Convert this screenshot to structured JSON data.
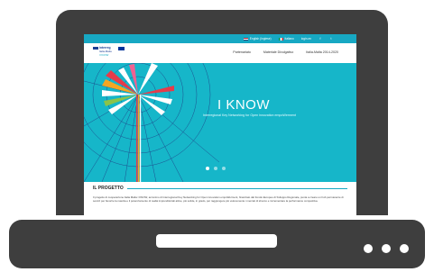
{
  "topbar": {
    "items": [
      {
        "label": "English (Inglese)",
        "flag": "en"
      },
      {
        "label": "Italiano",
        "flag": "it"
      },
      {
        "label": "login-ex"
      }
    ],
    "social": [
      "f",
      "t"
    ]
  },
  "header": {
    "logo": {
      "line1": "interreg",
      "line2": "Italia-Malta",
      "line3": "I KNOW"
    },
    "nav": [
      "Partenariato",
      "Materiale Divulgativo",
      "Italia-Malta 2014-2020"
    ]
  },
  "hero": {
    "title": "I KNOW",
    "subtitle": "Interregional Key Networking for Open innovation empoWerment",
    "slides": 3,
    "active_slide": 0
  },
  "section": {
    "title": "IL PROGETTO",
    "text": "Il progetto di cooperazione Italia Malta I KNOW, acronimo di Interregional Key Networking for Open innovation empoWerment, finanziato dal Fondo Europeo di Sviluppo Regionale, punta a creare un hub permanente di servizi per favorire la nascita e il potenziamento di realtà imprenditoriali attive, più solide, in grado, per raggiungere più velocemente i mercati di sbocco e incrementare la performance competitiva."
  },
  "colors": {
    "accent": "#17a8c3",
    "hero_bg": "#16b6c9",
    "laptop": "#3e3e3e"
  }
}
